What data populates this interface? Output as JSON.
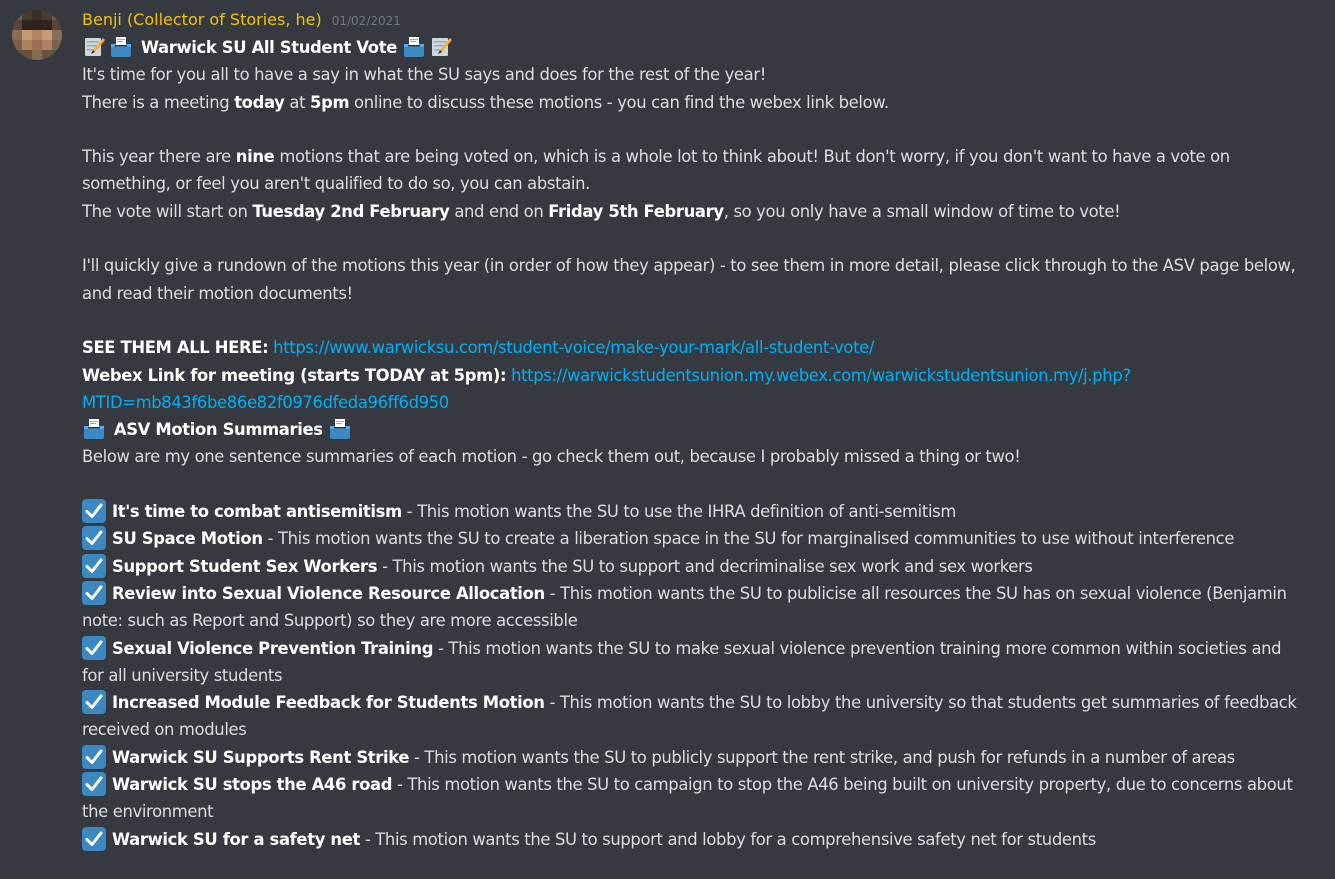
{
  "message": {
    "author": "Benji (Collector of Stories, he)",
    "timestamp": "01/02/2021",
    "title": "Warwick SU All Student Vote",
    "intro": [
      "It's time for you all to have a say in what the SU says and does for the rest of the year!",
      [
        "There is a meeting ",
        "today",
        " at ",
        "5pm",
        " online to discuss these motions - you can find the webex link below."
      ]
    ],
    "motions_count_line": [
      "This year there are ",
      "nine",
      " motions that are being voted on, which is a whole lot to think about! But don't worry, if you don't want to have a vote on something, or feel you aren't qualified to do so, you can abstain."
    ],
    "dates_line": [
      "The vote will start on ",
      "Tuesday 2nd February",
      " and end on ",
      "Friday 5th February",
      ", so you only have a small window of time to vote!"
    ],
    "rundown": "I'll quickly give a rundown of the motions this year (in order of how they appear) - to see them in more detail, please click through to the ASV page below, and read their motion documents!",
    "see_all_label": "SEE THEM ALL HERE:",
    "see_all_url": "https://www.warwicksu.com/student-voice/make-your-mark/all-student-vote/",
    "webex_label": "Webex Link for meeting (starts TODAY at 5pm):",
    "webex_url_1": "https://warwickstudentsunion.my.webex.com/warwickstudentsunion.my/j.php?",
    "webex_url_2": "MTID=mb843f6be86e82f0976dfeda96ff6d950",
    "summaries_title": "ASV Motion Summaries",
    "summaries_intro": "Below are my one sentence summaries of each motion - go check them out, because I probably missed a thing or two!",
    "motions": [
      {
        "name": "It's time to combat antisemitism",
        "desc": " - This motion wants the SU to use the IHRA definition of anti-semitism"
      },
      {
        "name": "SU Space Motion",
        "desc": " - This motion wants the SU to create a liberation space in the SU for marginalised communities to use without interference"
      },
      {
        "name": "Support Student Sex Workers",
        "desc": " - This motion wants the SU to support and decriminalise sex work and sex workers"
      },
      {
        "name": "Review into Sexual Violence Resource Allocation",
        "desc": " - This motion wants the SU to publicise all resources the SU has on sexual violence (Benjamin note: such as Report and Support) so they are more accessible"
      },
      {
        "name": "Sexual Violence Prevention Training",
        "desc": " - This motion wants the SU to make sexual violence prevention training more common within societies and for all university students"
      },
      {
        "name": "Increased Module Feedback for Students Motion",
        "desc": " - This motion wants the SU to lobby the university so that students get summaries of feedback received on modules"
      },
      {
        "name": "Warwick SU Supports Rent Strike",
        "desc": " - This motion wants the SU to publicly support the rent strike, and push for refunds in a number of areas"
      },
      {
        "name": "Warwick SU stops the A46 road",
        "desc": " - This motion wants the SU to campaign to stop the A46 being built on university property, due to concerns about the environment"
      },
      {
        "name": "Warwick SU for a safety net",
        "desc": " - This motion wants the SU to support and lobby for a comprehensive safety net for students"
      }
    ]
  },
  "colors": {
    "background": "#36393f",
    "text": "#dcddde",
    "username": "#f1c40f",
    "timestamp": "#72767d",
    "link": "#00aff4",
    "check": "#3b88c3"
  },
  "icons": [
    "memo-icon",
    "ballot-box-icon",
    "check-mark-icon",
    "avatar-pixel"
  ]
}
